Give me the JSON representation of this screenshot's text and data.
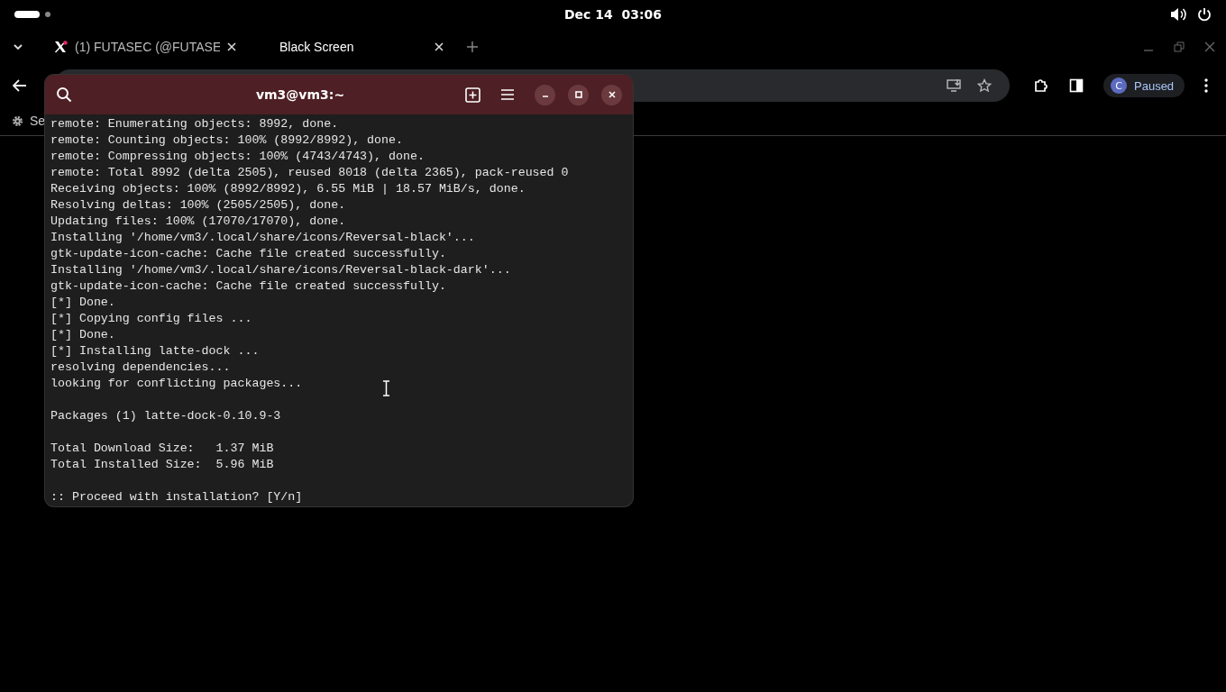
{
  "top_bar": {
    "clock": "Dec 14  03:06"
  },
  "browser": {
    "tabs": [
      {
        "title": "(1) FUTASEC (@FUTASE",
        "selected": false
      },
      {
        "title": "Black Screen",
        "selected": true
      }
    ],
    "profile": {
      "initial": "C",
      "status": "Paused"
    },
    "bookmarks": [
      {
        "label": "Se"
      }
    ]
  },
  "terminal": {
    "title": "vm3@vm3:~",
    "output_blocks": [
      [
        "remote: Enumerating objects: 8992, done.",
        "remote: Counting objects: 100% (8992/8992), done.",
        "remote: Compressing objects: 100% (4743/4743), done.",
        "remote: Total 8992 (delta 2505), reused 8018 (delta 2365), pack-reused 0",
        "Receiving objects: 100% (8992/8992), 6.55 MiB | 18.57 MiB/s, done.",
        "Resolving deltas: 100% (2505/2505), done.",
        "Updating files: 100% (17070/17070), done.",
        "Installing '/home/vm3/.local/share/icons/Reversal-black'...",
        "gtk-update-icon-cache: Cache file created successfully.",
        "Installing '/home/vm3/.local/share/icons/Reversal-black-dark'...",
        "gtk-update-icon-cache: Cache file created successfully.",
        "[*] Done.",
        "[*] Copying config files ...",
        "[*] Done.",
        "[*] Installing latte-dock ...",
        "resolving dependencies...",
        "looking for conflicting packages..."
      ],
      [
        "Packages (1) latte-dock-0.10.9-3"
      ],
      [
        "Total Download Size:   1.37 MiB",
        "Total Installed Size:  5.96 MiB"
      ],
      [
        ":: Proceed with installation? [Y/n]"
      ]
    ]
  }
}
